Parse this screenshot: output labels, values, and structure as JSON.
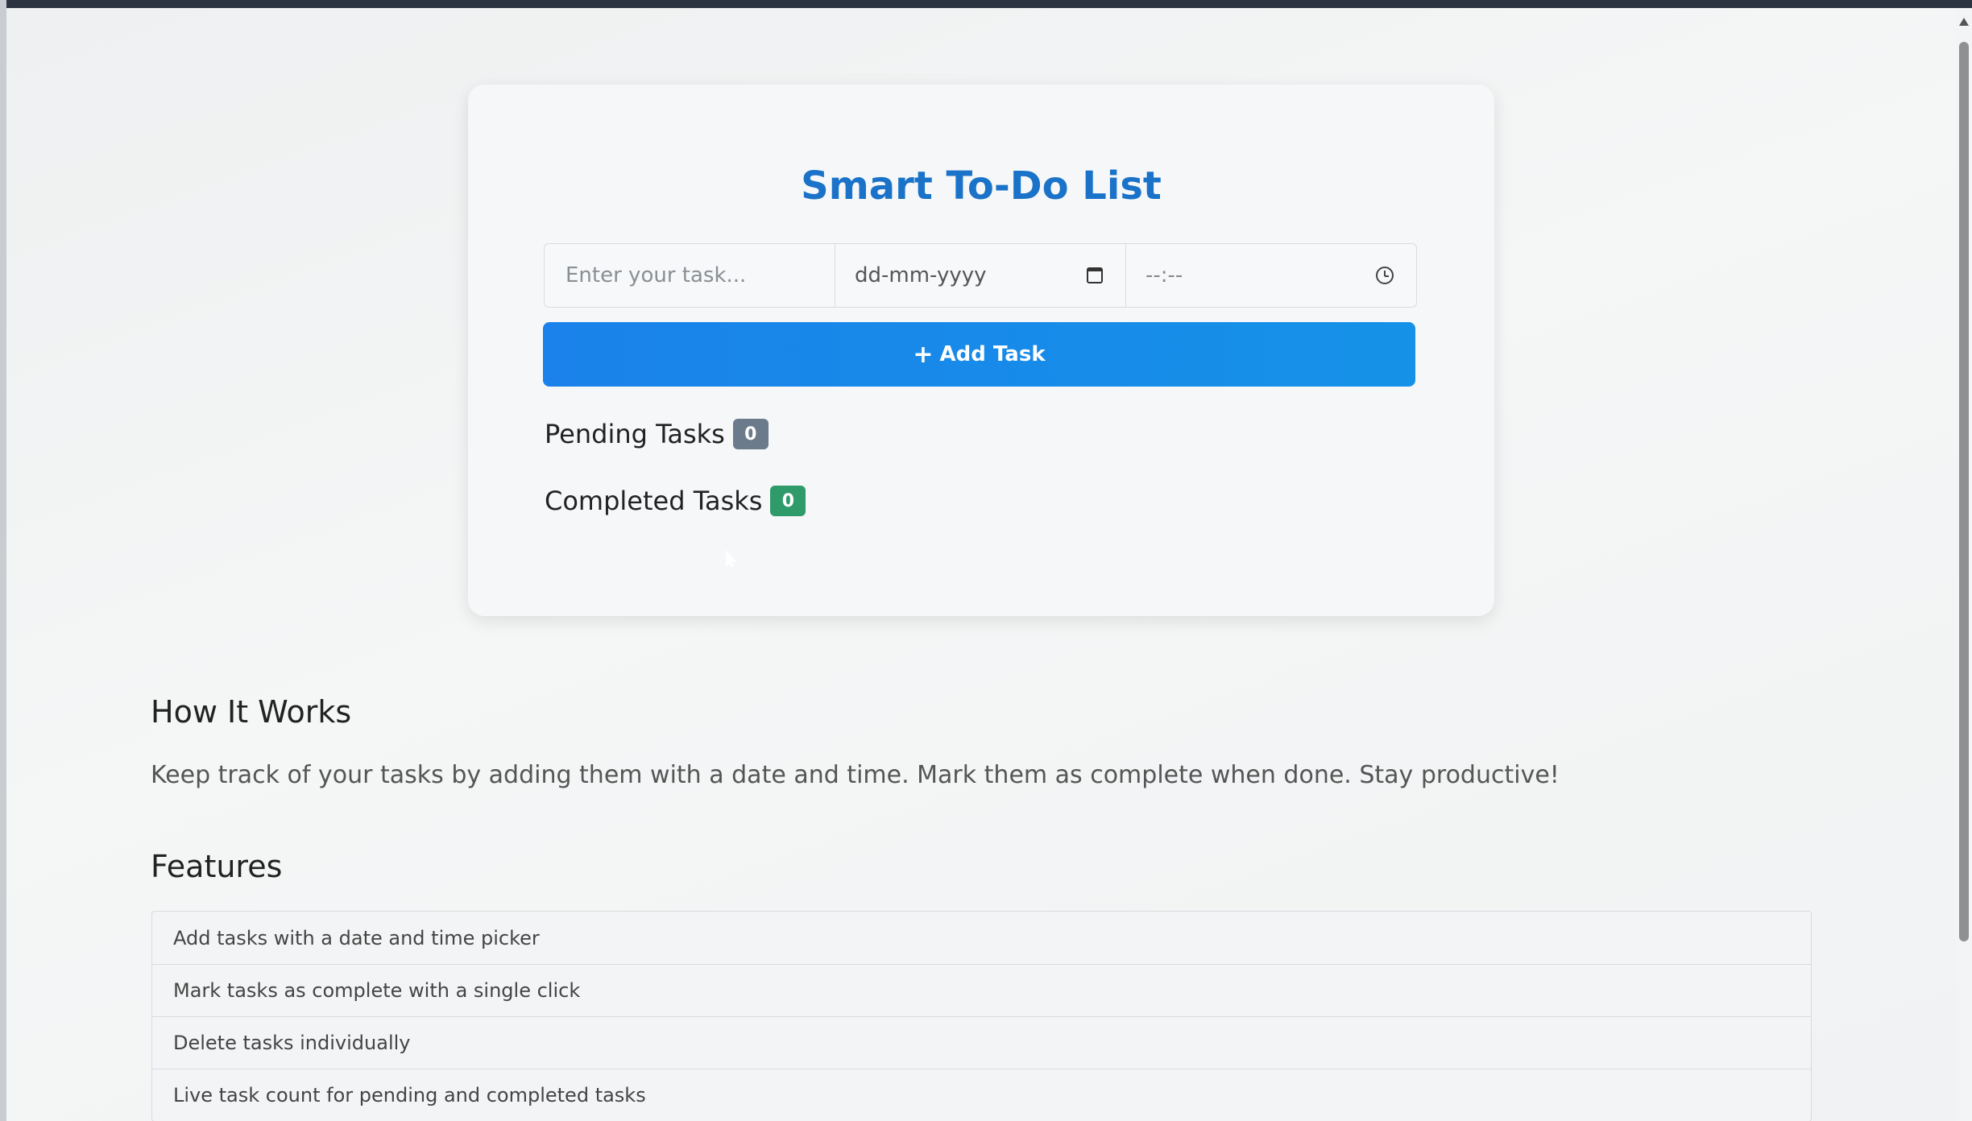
{
  "app": {
    "title": "Smart To-Do List"
  },
  "form": {
    "task_placeholder": "Enter your task...",
    "date_placeholder": "dd-mm-yyyy",
    "time_placeholder": "--:--",
    "date_icon": "calendar-icon",
    "time_icon": "clock-icon",
    "add_button_label": "Add Task",
    "add_button_icon": "+"
  },
  "counts": {
    "pending_label": "Pending Tasks",
    "pending_count": "0",
    "completed_label": "Completed Tasks",
    "completed_count": "0"
  },
  "how_it_works": {
    "title": "How It Works",
    "text": "Keep track of your tasks by adding them with a date and time. Mark them as complete when done. Stay productive!"
  },
  "features": {
    "title": "Features",
    "items": [
      "Add tasks with a date and time picker",
      "Mark tasks as complete with a single click",
      "Delete tasks individually",
      "Live task count for pending and completed tasks"
    ]
  },
  "colors": {
    "title": "#1a73c8",
    "button": "#1a82ea",
    "pending_badge": "#6c7b8b",
    "completed_badge": "#2f9a6a"
  }
}
